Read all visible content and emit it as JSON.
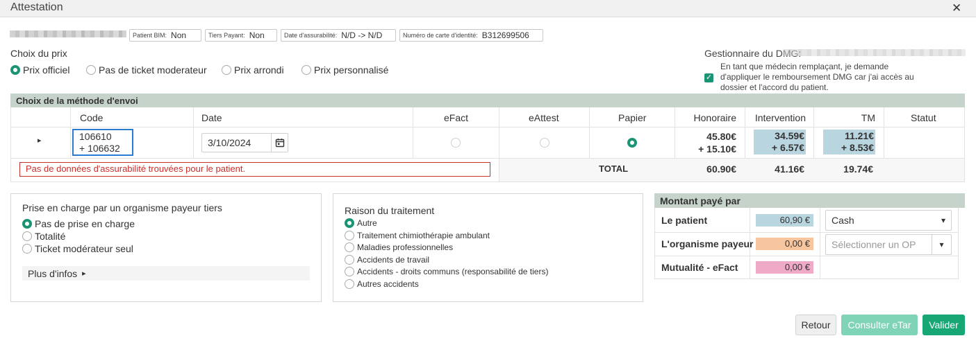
{
  "window": {
    "title": "Attestation",
    "close_glyph": "✕"
  },
  "patient_info": {
    "chips": [
      {
        "label": "Patient BIM:",
        "value": "Non"
      },
      {
        "label": "Tiers Payant:",
        "value": "Non"
      },
      {
        "label": "Date d'assurabilité:",
        "value": "N/D -> N/D"
      },
      {
        "label": "Numéro de carte d'identité:",
        "value": "B312699506"
      }
    ]
  },
  "price_choice": {
    "title": "Choix du prix",
    "options": [
      "Prix officiel",
      "Pas de ticket moderateur",
      "Prix arrondi",
      "Prix personnalisé"
    ],
    "selected": 0
  },
  "dmg": {
    "title": "Gestionnaire du DMG:",
    "checkbox_lines": [
      "En tant que médecin remplaçant, je demande",
      "d'appliquer le remboursement DMG car j'ai accès au",
      "dossier et l'accord du patient."
    ],
    "checked": true
  },
  "send_method": {
    "title": "Choix de la méthode d'envoi",
    "columns": [
      "Code",
      "Date",
      "eFact",
      "eAttest",
      "Papier",
      "Honoraire",
      "Intervention",
      "TM",
      "Statut"
    ],
    "row": {
      "code_line1": "106610",
      "code_line2": "+ 106632",
      "date": "3/10/2024",
      "method_selected": "Papier",
      "honoraire_line1": "45.80€",
      "honoraire_line2": "+ 15.10€",
      "intervention_line1": "34.59€",
      "intervention_line2": "+ 6.57€",
      "tm_line1": "11.21€",
      "tm_line2": "+ 8.53€"
    },
    "error": "Pas de données d'assurabilité trouvées pour le patient.",
    "total_label": "TOTAL",
    "total_honoraire": "60.90€",
    "total_intervention": "41.16€",
    "total_tm": "19.74€"
  },
  "third_party": {
    "title": "Prise en charge par un organisme payeur tiers",
    "options": [
      "Pas de prise en charge",
      "Totalité",
      "Ticket modérateur seul"
    ],
    "selected": 0,
    "more_info": "Plus d'infos",
    "more_info_glyph": "▸"
  },
  "treatment_reason": {
    "title": "Raison du traitement",
    "options": [
      "Autre",
      "Traitement chimiothérapie ambulant",
      "Maladies professionnelles",
      "Accidents de travail",
      "Accidents - droits communs (responsabilité de tiers)",
      "Autres accidents"
    ],
    "selected": 0
  },
  "payment": {
    "title": "Montant payé par",
    "rows": [
      {
        "label": "Le patient",
        "amount": "60,90 €",
        "color": "#b9d5e0",
        "select_value": "Cash",
        "select_placeholder": ""
      },
      {
        "label": "L'organisme payeur",
        "amount": "0,00 €",
        "color": "#f7c59e",
        "select_value": "",
        "select_placeholder": "Sélectionner un OP"
      },
      {
        "label": "Mutualité - eFact",
        "amount": "0,00 €",
        "color": "#eeaac7",
        "select_value": "",
        "select_placeholder": ""
      }
    ]
  },
  "buttons": {
    "back": "Retour",
    "etar": "Consulter eTar",
    "validate": "Valider"
  },
  "icons": {
    "expand": "▸",
    "calendar": "calendar-icon",
    "dropdown": "▾"
  },
  "colors": {
    "accent": "#1a9474",
    "section_header": "#c6d3cb",
    "cell_blue": "#b9d5e0",
    "error_red": "#c9302c"
  }
}
